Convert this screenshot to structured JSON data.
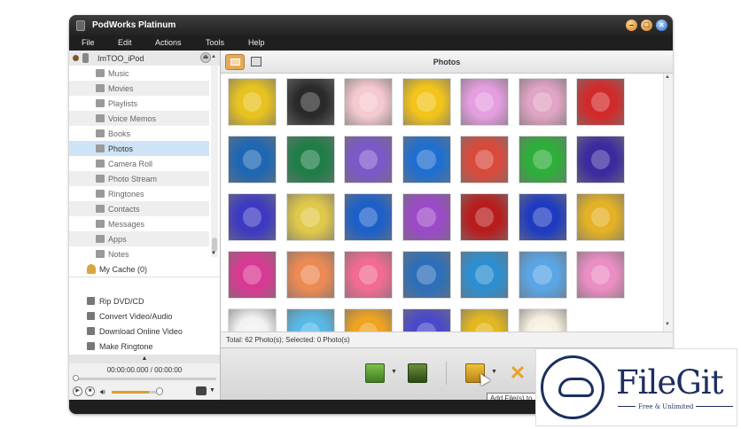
{
  "window": {
    "title": "PodWorks Platinum"
  },
  "menu": [
    "File",
    "Edit",
    "Actions",
    "Tools",
    "Help"
  ],
  "sidebar": {
    "device": "ImTOO_iPod",
    "items": [
      {
        "label": "Music",
        "icon": "music-icon"
      },
      {
        "label": "Movies",
        "icon": "movie-icon"
      },
      {
        "label": "Playlists",
        "icon": "playlist-icon"
      },
      {
        "label": "Voice Memos",
        "icon": "voice-memo-icon"
      },
      {
        "label": "Books",
        "icon": "book-icon"
      },
      {
        "label": "Photos",
        "icon": "photo-icon"
      },
      {
        "label": "Camera Roll",
        "icon": "camera-icon"
      },
      {
        "label": "Photo Stream",
        "icon": "photo-stream-icon"
      },
      {
        "label": "Ringtones",
        "icon": "ringtone-icon"
      },
      {
        "label": "Contacts",
        "icon": "contacts-icon"
      },
      {
        "label": "Messages",
        "icon": "messages-icon"
      },
      {
        "label": "Apps",
        "icon": "apps-icon"
      },
      {
        "label": "Notes",
        "icon": "notes-icon"
      }
    ],
    "selected": "Photos",
    "cache": "My Cache (0)",
    "tools": [
      {
        "label": "Rip DVD/CD",
        "icon": "disc-icon"
      },
      {
        "label": "Convert Video/Audio",
        "icon": "convert-icon"
      },
      {
        "label": "Download Online Video",
        "icon": "download-icon"
      },
      {
        "label": "Make Ringtone",
        "icon": "bell-icon"
      }
    ]
  },
  "player": {
    "time": "00:00:00.000 / 00:00:00",
    "volume_level": 0.75
  },
  "content": {
    "title": "Photos",
    "status": "Total: 62 Photo(s); Selected: 0 Photo(s)",
    "photos": [
      [
        "#e8c320",
        "#2a2a2a",
        "#f5c9d0",
        "#f3c51b",
        "#e59ee0",
        "#e0a4c4",
        "#d22a2a"
      ],
      [
        "#1d67b5",
        "#1f7d48",
        "#7d58c8",
        "#1f6fd0",
        "#d94a3c",
        "#2eae3a",
        "#3b2aa0"
      ],
      [
        "#3d3ac2",
        "#e0c84a",
        "#1d60c9",
        "#9b4ac8",
        "#b91c1c",
        "#1f3bc0",
        "#e4b224"
      ],
      [
        "#d73a92",
        "#ec8a54",
        "#f16b92",
        "#2d6fb8",
        "#2d8fd1",
        "#5aa5e6",
        "#ea8ec3"
      ],
      [
        "#f2f2f2",
        "#58b9e6",
        "#f0a321",
        "#4a49c9",
        "#e3b720",
        "#f7f0e0"
      ]
    ]
  },
  "toolbar": {
    "buttons": [
      "add-to-device-icon",
      "export-icon",
      "add-file-icon",
      "delete-icon"
    ],
    "tooltip": "Add File(s) to"
  },
  "watermark": {
    "name": "FileGit",
    "tagline": "Free & Unlimited"
  }
}
